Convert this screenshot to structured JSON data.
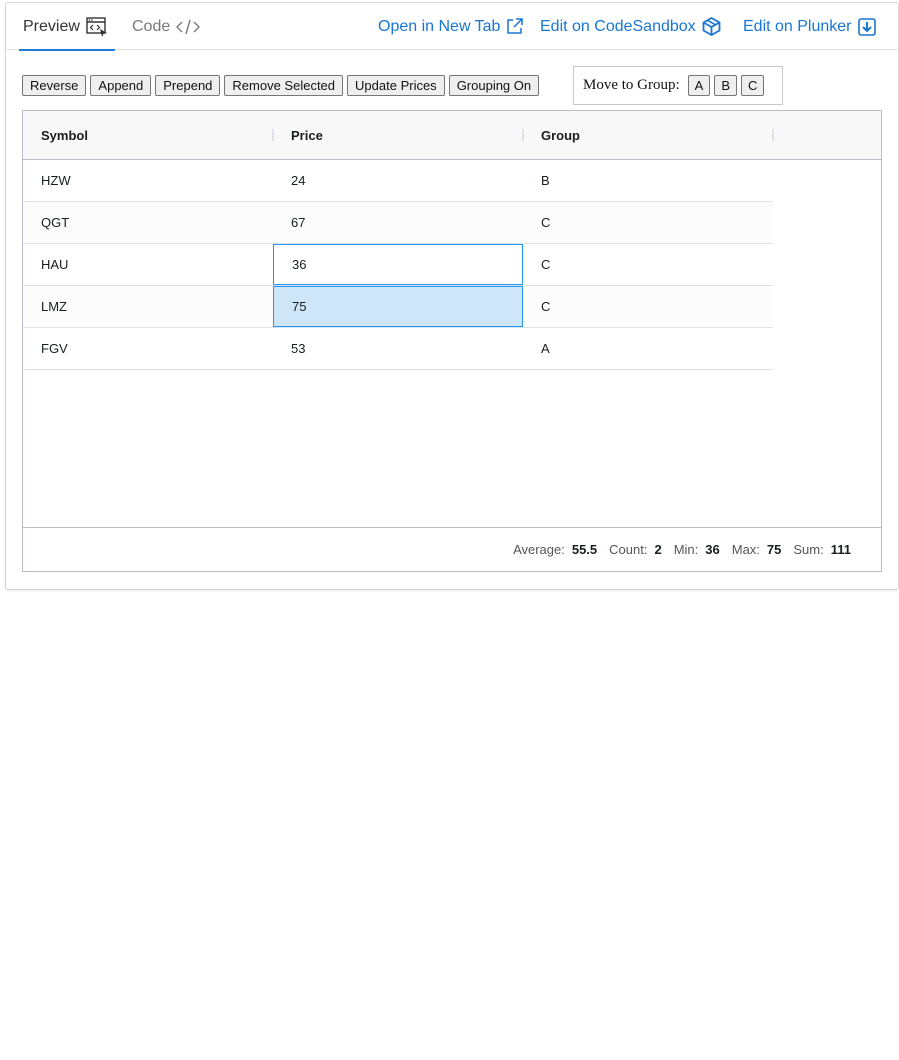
{
  "tabs": {
    "preview": "Preview",
    "code": "Code"
  },
  "links": {
    "open_new_tab": "Open in New Tab",
    "edit_codesandbox": "Edit on CodeSandbox",
    "edit_plunker": "Edit on Plunker"
  },
  "toolbar": {
    "reverse": "Reverse",
    "append": "Append",
    "prepend": "Prepend",
    "remove_selected": "Remove Selected",
    "update_prices": "Update Prices",
    "grouping_on": "Grouping On"
  },
  "move_group": {
    "label": "Move to Group:",
    "a": "A",
    "b": "B",
    "c": "C"
  },
  "grid": {
    "columns": [
      "Symbol",
      "Price",
      "Group"
    ],
    "rows": [
      [
        "HZW",
        "24",
        "B"
      ],
      [
        "QGT",
        "67",
        "C"
      ],
      [
        "HAU",
        "36",
        "C"
      ],
      [
        "LMZ",
        "75",
        "C"
      ],
      [
        "FGV",
        "53",
        "A"
      ]
    ],
    "focused_row": 2,
    "selected_row": 3
  },
  "status": {
    "average_label": "Average:",
    "average": "55.5",
    "count_label": "Count:",
    "count": "2",
    "min_label": "Min:",
    "min": "36",
    "max_label": "Max:",
    "max": "75",
    "sum_label": "Sum:",
    "sum": "111"
  },
  "colors": {
    "accent": "#1976d2",
    "selection": "#cfe5f8",
    "focus_border": "#2196f3"
  }
}
